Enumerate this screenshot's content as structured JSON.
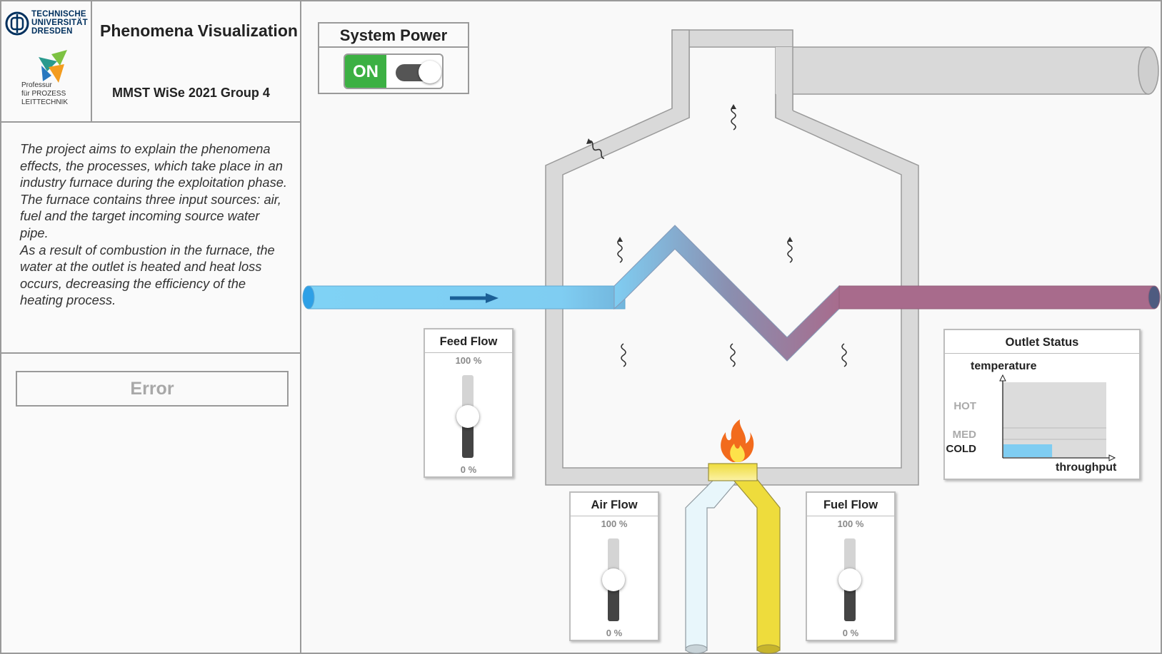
{
  "header": {
    "university_name": "TECHNISCHE\nUNIVERSITÄT\nDRESDEN",
    "chair_name": "Professur\nfür PROZESS\nLEITTECHNIK",
    "title": "Phenomena Visualization",
    "subtitle": "MMST WiSe 2021 Group 4"
  },
  "description": {
    "paragraph1": "The project aims to explain the phenomena effects, the processes, which take place in an industry furnace during the exploitation phase.",
    "paragraph2": "The furnace contains three input sources: air, fuel and the target incoming source water pipe.",
    "paragraph3": "As a result of combustion in the furnace, the water at the outlet is heated and heat loss occurs, decreasing the efficiency of the heating process."
  },
  "status": {
    "error_label": "Error"
  },
  "power": {
    "title": "System Power",
    "state_label": "ON",
    "is_on": true
  },
  "sliders": {
    "feed": {
      "title": "Feed Flow",
      "max_label": "100 %",
      "min_label": "0 %",
      "value_fraction": 0.5
    },
    "air": {
      "title": "Air Flow",
      "max_label": "100 %",
      "min_label": "0 %",
      "value_fraction": 0.5
    },
    "fuel": {
      "title": "Fuel Flow",
      "max_label": "100 %",
      "min_label": "0 %",
      "value_fraction": 0.5
    }
  },
  "outlet": {
    "title": "Outlet Status",
    "y_label": "temperature",
    "x_label": "throughput",
    "levels": {
      "hot": "HOT",
      "med": "MED",
      "cold": "COLD"
    },
    "current_level": "COLD",
    "throughput_fraction": 0.47
  },
  "colors": {
    "inlet_water": "#7fcdf2",
    "outlet_water": "#a86b8c",
    "air": "#e8f6fb",
    "fuel": "#eedc3c",
    "wall": "#d9d9d9",
    "power_on": "#3cb043",
    "cold_bar": "#7fcdf2"
  },
  "icons": [
    "flow-arrow-icon",
    "flame-icon",
    "heat-wave-icon"
  ]
}
